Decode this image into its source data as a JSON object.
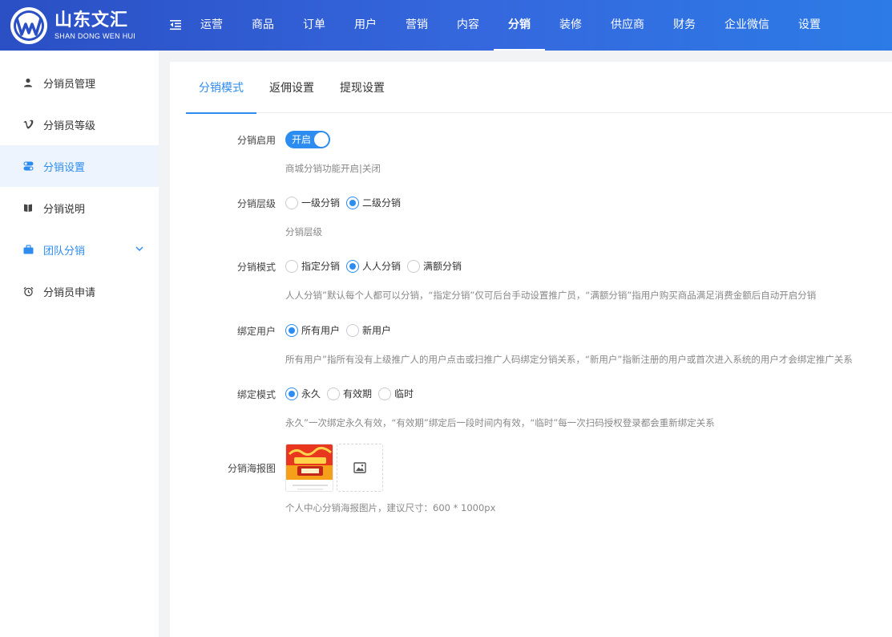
{
  "brand": {
    "name_cn": "山东文汇",
    "name_en": "SHAN DONG WEN HUI"
  },
  "top_nav": [
    {
      "label": "运营"
    },
    {
      "label": "商品"
    },
    {
      "label": "订单"
    },
    {
      "label": "用户"
    },
    {
      "label": "营销"
    },
    {
      "label": "内容"
    },
    {
      "label": "分销",
      "active": true
    },
    {
      "label": "装修"
    },
    {
      "label": "供应商"
    },
    {
      "label": "财务"
    },
    {
      "label": "企业微信"
    },
    {
      "label": "设置"
    }
  ],
  "sidebar": {
    "items": [
      {
        "label": "分销员管理",
        "icon": "user-icon"
      },
      {
        "label": "分销员等级",
        "icon": "vimeo-v-icon"
      },
      {
        "label": "分销设置",
        "icon": "toggle-settings-icon",
        "active": true
      },
      {
        "label": "分销说明",
        "icon": "book-icon"
      },
      {
        "label": "团队分销",
        "icon": "briefcase-icon",
        "expandable": true
      },
      {
        "label": "分销员申请",
        "icon": "alarm-clock-icon"
      }
    ]
  },
  "tabs": [
    {
      "label": "分销模式",
      "active": true
    },
    {
      "label": "返佣设置"
    },
    {
      "label": "提现设置"
    }
  ],
  "form": {
    "enable": {
      "label": "分销启用",
      "switch_text": "开启",
      "value": true,
      "hint": "商城分销功能开启|关闭"
    },
    "level": {
      "label": "分销层级",
      "options": [
        "一级分销",
        "二级分销"
      ],
      "selected": "二级分销",
      "hint": "分销层级"
    },
    "mode": {
      "label": "分销模式",
      "options": [
        "指定分销",
        "人人分销",
        "满额分销"
      ],
      "selected": "人人分销",
      "hint": "人人分销”默认每个人都可以分销，“指定分销”仅可后台手动设置推广员，“满额分销”指用户购买商品满足消费金额后自动开启分销"
    },
    "bind_user": {
      "label": "绑定用户",
      "options": [
        "所有用户",
        "新用户"
      ],
      "selected": "所有用户",
      "hint": "所有用户”指所有没有上级推广人的用户点击或扫推广人码绑定分销关系，“新用户”指新注册的用户或首次进入系统的用户才会绑定推广关系"
    },
    "bind_mode": {
      "label": "绑定模式",
      "options": [
        "永久",
        "有效期",
        "临时"
      ],
      "selected": "永久",
      "hint": "永久”一次绑定永久有效，“有效期”绑定后一段时间内有效，“临时”每一次扫码授权登录都会重新绑定关系"
    },
    "poster": {
      "label": "分销海报图",
      "hint": "个人中心分销海报图片，建议尺寸：600 * 1000px"
    }
  },
  "colors": {
    "primary": "#2d8cf0",
    "header_start": "#2b4fc4",
    "header_end": "#2c7be6",
    "active_bg": "#eef4fd"
  }
}
